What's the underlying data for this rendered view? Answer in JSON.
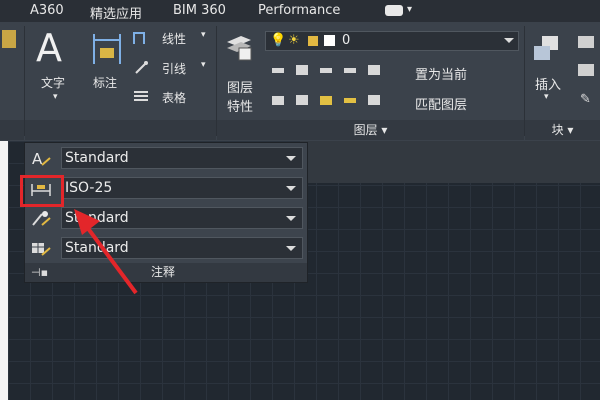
{
  "tabs": [
    "A360",
    "精选应用",
    "BIM 360",
    "Performance"
  ],
  "annotate_panel": {
    "text_label": "文字",
    "dim_label": "标注",
    "linear_label": "线性",
    "leader_label": "引线",
    "table_label": "表格"
  },
  "layers_panel": {
    "layer_props_line1": "图层",
    "layer_props_line2": "特性",
    "current_layer": "0",
    "set_current": "置为当前",
    "match_layer": "匹配图层",
    "panel_title": "图层 ▾"
  },
  "block_panel": {
    "insert_label": "插入",
    "panel_title": "块 ▾"
  },
  "flyout": {
    "text_style": "Standard",
    "dim_style": "ISO-25",
    "mleader_style": "Standard",
    "table_style": "Standard",
    "footer": "注释"
  }
}
